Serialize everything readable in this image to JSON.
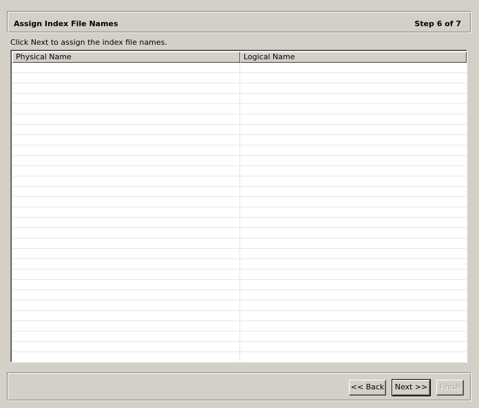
{
  "header": {
    "title": "Assign Index File Names",
    "step": "Step 6 of 7"
  },
  "instruction": "Click Next to assign the index file names.",
  "table": {
    "columns": [
      "Physical Name",
      "Logical Name"
    ],
    "rows": []
  },
  "buttons": {
    "back": "<< Back",
    "next": "Next >>",
    "finish": "Finish"
  },
  "colors": {
    "window_bg": "#d4d0c8",
    "table_bg": "#ffffff",
    "grid_line": "#e6e6e6",
    "disabled_text": "#a0a0a0"
  }
}
